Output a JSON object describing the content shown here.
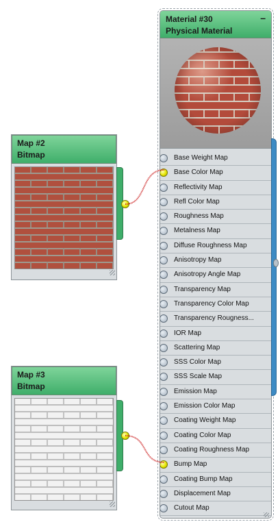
{
  "map_nodes": [
    {
      "title": "Map #2",
      "subtitle": "Bitmap",
      "texture": "red-brick"
    },
    {
      "title": "Map #3",
      "subtitle": "Bitmap",
      "texture": "white-brick"
    }
  ],
  "material_node": {
    "title": "Material #30",
    "subtitle": "Physical Material",
    "collapse_label": "–",
    "slots": [
      {
        "label": "Base Weight Map",
        "connected": false
      },
      {
        "label": "Base Color Map",
        "connected": true
      },
      {
        "label": "Reflectivity Map",
        "connected": false
      },
      {
        "label": "Refl Color Map",
        "connected": false
      },
      {
        "label": "Roughness Map",
        "connected": false
      },
      {
        "label": "Metalness Map",
        "connected": false
      },
      {
        "label": "Diffuse Roughness Map",
        "connected": false
      },
      {
        "label": "Anisotropy Map",
        "connected": false
      },
      {
        "label": "Anisotropy Angle Map",
        "connected": false
      },
      {
        "label": "Transparency Map",
        "connected": false
      },
      {
        "label": "Transparency Color Map",
        "connected": false
      },
      {
        "label": "Transparency Rougness...",
        "connected": false
      },
      {
        "label": "IOR Map",
        "connected": false
      },
      {
        "label": "Scattering Map",
        "connected": false
      },
      {
        "label": "SSS Color Map",
        "connected": false
      },
      {
        "label": "SSS Scale Map",
        "connected": false
      },
      {
        "label": "Emission Map",
        "connected": false
      },
      {
        "label": "Emission Color Map",
        "connected": false
      },
      {
        "label": "Coating Weight Map",
        "connected": false
      },
      {
        "label": "Coating Color Map",
        "connected": false
      },
      {
        "label": "Coating Roughness Map",
        "connected": false
      },
      {
        "label": "Bump Map",
        "connected": true
      },
      {
        "label": "Coating Bump Map",
        "connected": false
      },
      {
        "label": "Displacement Map",
        "connected": false
      },
      {
        "label": "Cutout Map",
        "connected": false
      }
    ]
  },
  "colors": {
    "node_header": "#3fae6a",
    "wire": "#cc2222",
    "socket_connected": "#e6e600",
    "output_bar": "#3d8bc4"
  }
}
